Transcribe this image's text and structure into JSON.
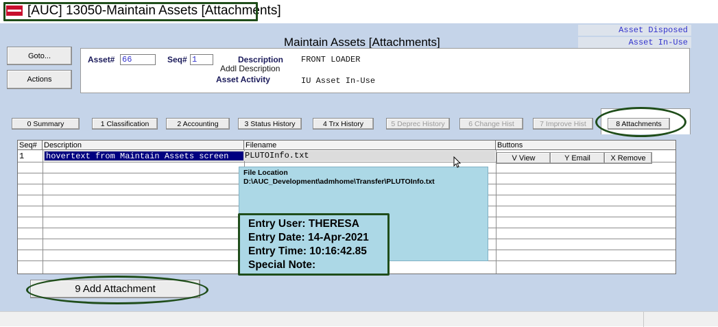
{
  "window": {
    "title": "[AUC] 13050-Maintain Assets [Attachments]"
  },
  "form": {
    "title": "Maintain Assets [Attachments]",
    "status": [
      "Asset Disposed",
      "Asset In-Use"
    ]
  },
  "side_buttons": {
    "goto": "Goto...",
    "actions": "Actions"
  },
  "header": {
    "asset_label": "Asset#",
    "asset_value": "66",
    "seq_label": "Seq#",
    "seq_value": "1",
    "description_label": "Description",
    "description_value": "FRONT LOADER",
    "addl_description_label": "Addl Description",
    "addl_description_value": "",
    "activity_label": "Asset Activity",
    "activity_value": "IU Asset In-Use"
  },
  "tabs": [
    {
      "label": "0 Summary",
      "enabled": true
    },
    {
      "label": "1 Classification",
      "enabled": true
    },
    {
      "label": "2 Accounting",
      "enabled": true
    },
    {
      "label": "3 Status History",
      "enabled": true
    },
    {
      "label": "4 Trx History",
      "enabled": true
    },
    {
      "label": "5 Deprec History",
      "enabled": false
    },
    {
      "label": "6 Change Hist",
      "enabled": false
    },
    {
      "label": "7 Improve Hist",
      "enabled": false
    },
    {
      "label": "8 Attachments",
      "enabled": true,
      "active": true
    }
  ],
  "grid": {
    "columns": [
      "Seq#",
      "Description",
      "Filename",
      "Buttons"
    ],
    "rows": [
      {
        "seq": "1",
        "description": "hovertext from Maintain Assets screen",
        "filename": "PLUTOInfo.txt"
      }
    ],
    "row_buttons": [
      "V View",
      "Y Email",
      "X Remove"
    ]
  },
  "tooltip": {
    "title": "File Location",
    "path": "D:\\AUC_Development\\admhome\\Transfer\\PLUTOInfo.txt",
    "entry_user": "Entry User: THERESA",
    "entry_date": "Entry Date: 14-Apr-2021",
    "entry_time": "Entry Time: 10:16:42.85",
    "special_note": "Special Note:"
  },
  "add_button": "9 Add Attachment",
  "colors": {
    "panel": "#c5d4e9",
    "highlight": "#1f4d1a",
    "tooltip": "#acd8e6",
    "selected_cell": "#000080",
    "status_text": "#3333cc"
  }
}
